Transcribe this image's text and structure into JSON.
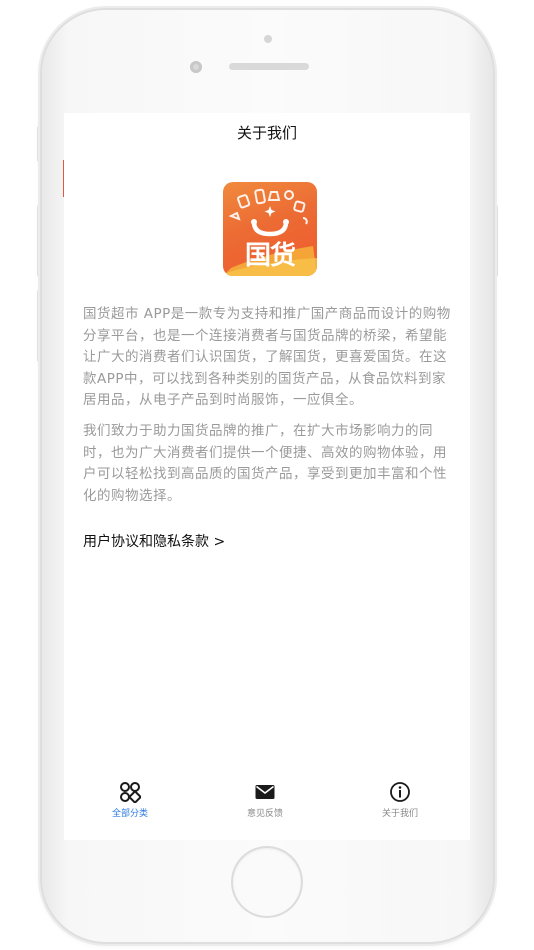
{
  "page": {
    "title": "关于我们"
  },
  "logo": {
    "text": "国货",
    "brand_color": "#ef5a2e"
  },
  "content": {
    "paragraph1": "国货超市 APP是一款专为支持和推广国产商品而设计的购物分享平台，也是一个连接消费者与国货品牌的桥梁，希望能让广大的消费者们认识国货，了解国货，更喜爱国货。在这款APP中，可以找到各种类别的国货产品，从食品饮料到家居用品，从电子产品到时尚服饰，一应俱全。",
    "paragraph2": "我们致力于助力国货品牌的推广，在扩大市场影响力的同时，也为广大消费者们提供一个便捷、高效的购物体验，用户可以轻松找到高品质的国货产品，享受到更加丰富和个性化的购物选择。",
    "agreement_link": "用户协议和隐私条款 >"
  },
  "tabbar": {
    "items": [
      {
        "label": "全部分类",
        "icon": "grid-icon",
        "active": true
      },
      {
        "label": "意见反馈",
        "icon": "mail-icon",
        "active": false
      },
      {
        "label": "关于我们",
        "icon": "info-icon",
        "active": false
      }
    ],
    "active_color": "#2d7be0"
  }
}
